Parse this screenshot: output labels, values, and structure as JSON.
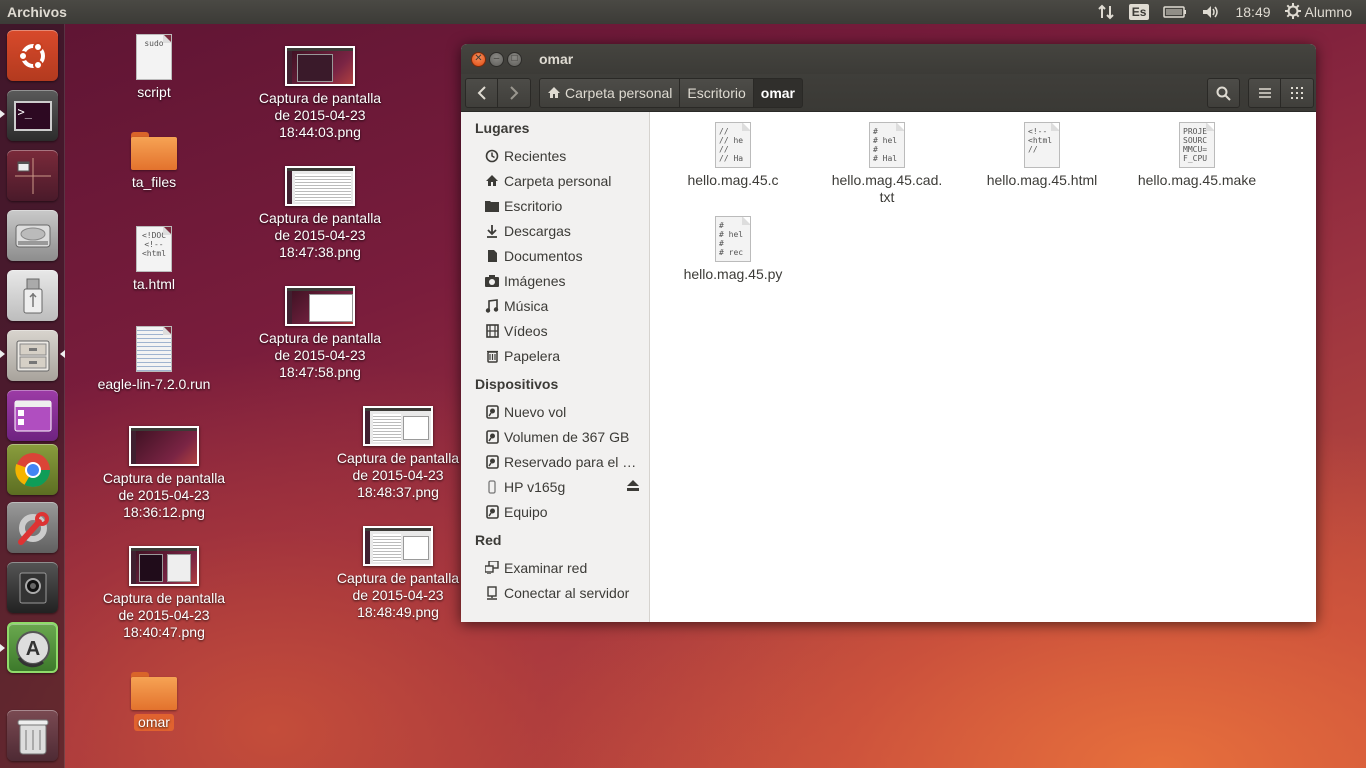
{
  "panel": {
    "app_title": "Archivos",
    "lang": "Es",
    "time": "18:49",
    "user": "Alumno"
  },
  "launcher": [
    {
      "name": "ubuntu-dash-icon"
    },
    {
      "name": "terminal-icon"
    },
    {
      "name": "workspace-switcher-icon"
    },
    {
      "name": "hard-drive-icon"
    },
    {
      "name": "usb-drive-icon"
    },
    {
      "name": "file-manager-icon"
    },
    {
      "name": "purple-app-icon"
    },
    {
      "name": "chrome-icon"
    },
    {
      "name": "system-settings-icon"
    },
    {
      "name": "webcam-app-icon"
    },
    {
      "name": "software-updater-icon"
    },
    {
      "name": "trash-icon"
    }
  ],
  "desktop": {
    "script": "script",
    "script_paper": "sudo",
    "ta_files": "ta_files",
    "ta_html": "ta.html",
    "ta_html_paper": "<!DOC\n<!--\n<html",
    "eagle": "eagle-lin-7.2.0.run",
    "cap_1": "Captura de pantalla\nde 2015-04-23\n18:36:12.png",
    "cap_2": "Captura de pantalla\nde 2015-04-23\n18:40:47.png",
    "omar": "omar",
    "cap_3": "Captura de pantalla\nde 2015-04-23\n18:44:03.png",
    "cap_4": "Captura de pantalla\nde 2015-04-23\n18:47:38.png",
    "cap_5": "Captura de pantalla\nde 2015-04-23\n18:47:58.png",
    "cap_6": "Captura de pantalla\nde 2015-04-23\n18:48:37.png",
    "cap_7": "Captura de pantalla\nde 2015-04-23\n18:48:49.png"
  },
  "window": {
    "title": "omar",
    "breadcrumbs": [
      "Carpeta personal",
      "Escritorio",
      "omar"
    ]
  },
  "sidebar": {
    "places_heading": "Lugares",
    "places": [
      "Recientes",
      "Carpeta personal",
      "Escritorio",
      "Descargas",
      "Documentos",
      "Imágenes",
      "Música",
      "Vídeos",
      "Papelera"
    ],
    "devices_heading": "Dispositivos",
    "devices": [
      "Nuevo vol",
      "Volumen de 367 GB",
      "Reservado para el …",
      "HP v165g",
      "Equipo"
    ],
    "network_heading": "Red",
    "network": [
      "Examinar red",
      "Conectar al servidor"
    ]
  },
  "files": [
    {
      "name": "hello.mag.45.c",
      "preview": "//\n// he\n//\n// Ha"
    },
    {
      "name": "hello.mag.45.cad.\ntxt",
      "preview": "#\n# hel\n#\n# Hal"
    },
    {
      "name": "hello.mag.45.html",
      "preview": "<!--\n<html\n//"
    },
    {
      "name": "hello.mag.45.make",
      "preview": "PROJE\nSOURC\nMMCU=\nF_CPU"
    },
    {
      "name": "hello.mag.45.py",
      "preview": "#\n# hel\n#\n# rec"
    }
  ]
}
